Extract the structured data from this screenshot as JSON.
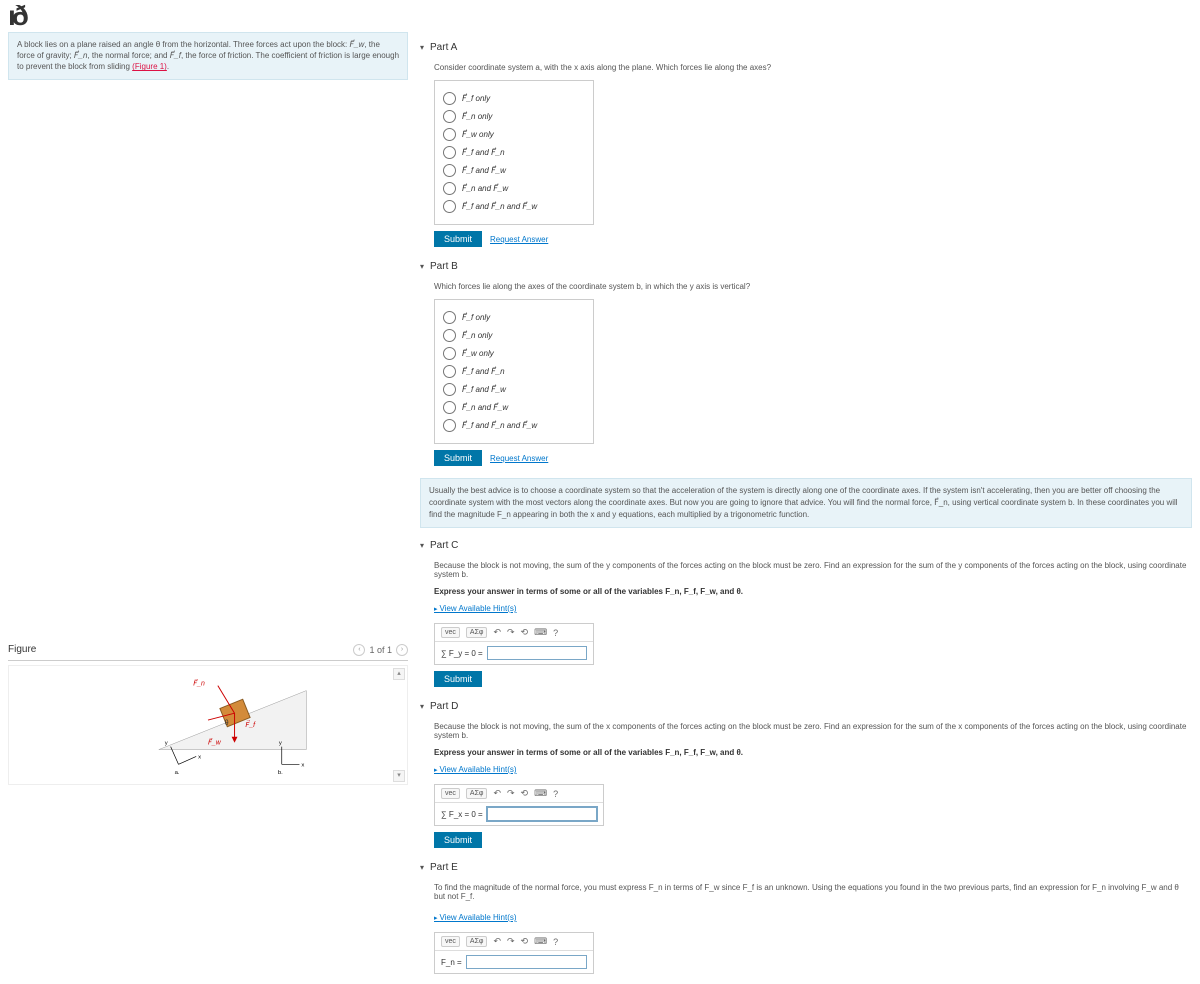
{
  "logo": "ıð",
  "intro": {
    "text_a": "A block lies on a plane raised an angle θ from the horizontal. Three forces act upon the block: ",
    "fw": "F⃗_w",
    "text_b": ", the force of gravity; ",
    "fn": "F⃗_n",
    "text_c": ", the normal force; and ",
    "ff": "F⃗_f",
    "text_d": ", the force of friction. The coefficient of friction is large enough to prevent the block from sliding ",
    "figure_link": "(Figure 1)",
    "text_e": "."
  },
  "figure": {
    "title": "Figure",
    "page": "1 of 1"
  },
  "options": [
    "F⃗_f only",
    "F⃗_n only",
    "F⃗_w only",
    "F⃗_f and F⃗_n",
    "F⃗_f and F⃗_w",
    "F⃗_n and F⃗_w",
    "F⃗_f and F⃗_n and F⃗_w"
  ],
  "buttons": {
    "submit": "Submit",
    "request": "Request Answer",
    "hints": "View Available Hint(s)"
  },
  "toolbar": {
    "tpl": "ΑΣφ",
    "vec": "vec",
    "undo": "↶",
    "redo": "↷",
    "reset": "⟲",
    "kbd": "⌨",
    "help": "?"
  },
  "partA": {
    "title": "Part A",
    "q": "Consider coordinate system a, with the x axis along the plane. Which forces lie along the axes?"
  },
  "partB": {
    "title": "Part B",
    "q": "Which forces lie along the axes of the coordinate system b, in which the y axis is vertical?"
  },
  "infoCB": "Usually the best advice is to choose a coordinate system so that the acceleration of the system is directly along one of the coordinate axes. If the system isn't accelerating, then you are better off choosing the coordinate system with the most vectors along the coordinate axes. But now you are going to ignore that advice. You will find the normal force, F⃗_n, using vertical coordinate system b. In these coordinates you will find the magnitude F_n appearing in both the x and y equations, each multiplied by a trigonometric function.",
  "partC": {
    "title": "Part C",
    "q": "Because the block is not moving, the sum of the y components of the forces acting on the block must be zero. Find an expression for the sum of the y components of the forces acting on the block, using coordinate system b.",
    "instr": "Express your answer in terms of some or all of the variables F_n, F_f, F_w, and θ.",
    "prefix": "∑ F_y = 0 ="
  },
  "partD": {
    "title": "Part D",
    "q": "Because the block is not moving, the sum of the x components of the forces acting on the block must be zero. Find an expression for the sum of the x components of the forces acting on the block, using coordinate system b.",
    "instr": "Express your answer in terms of some or all of the variables F_n, F_f, F_w, and θ.",
    "prefix": "∑ F_x = 0 ="
  },
  "partE": {
    "title": "Part E",
    "q": "To find the magnitude of the normal force, you must express F_n in terms of F_w since F_f is an unknown. Using the equations you found in the two previous parts, find an expression for F_n involving F_w and θ but not F_f.",
    "prefix": "F_n ="
  }
}
